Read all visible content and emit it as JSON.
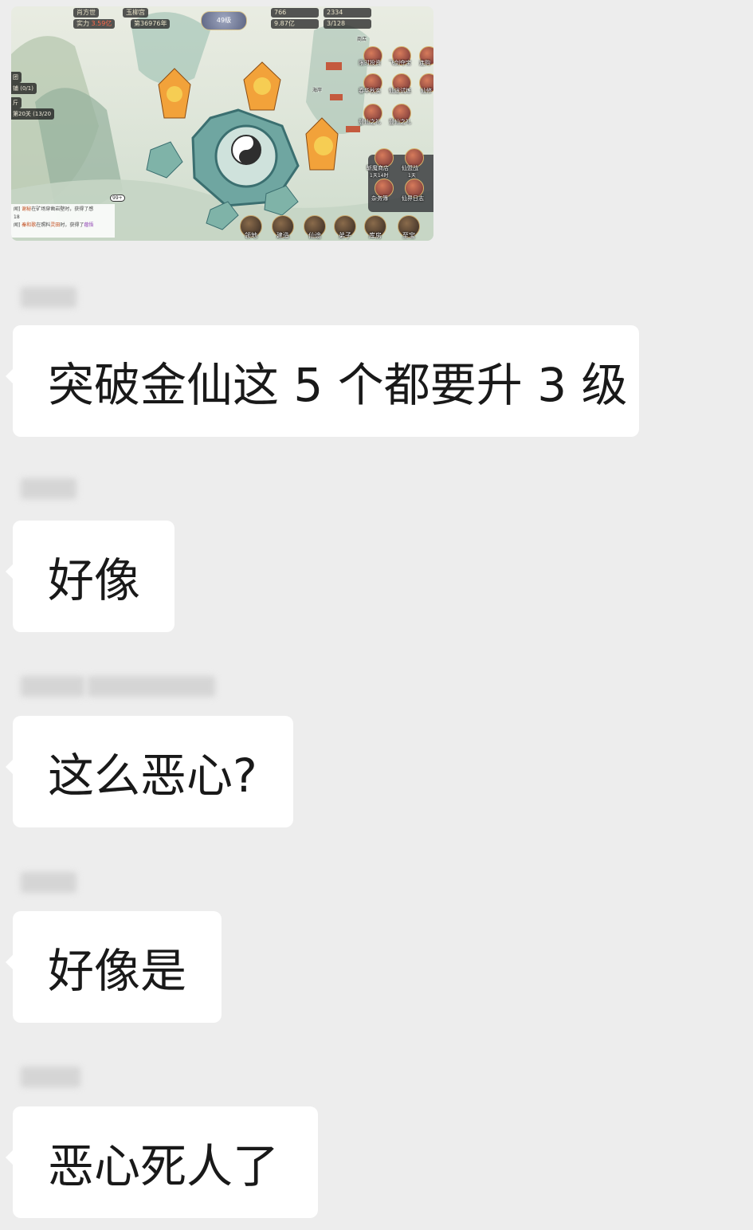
{
  "game_screenshot": {
    "top_bar": {
      "player_name": "肖方世",
      "sect_name": "玉柳宫",
      "power_label": "实力",
      "power_value": "3.59亿",
      "rank_text": "第36976年",
      "level_badge": "49级",
      "res1": "766",
      "res2": "2334",
      "res3": "9.87亿",
      "res4": "3/128"
    },
    "side_tasks": [
      "团",
      "铺 (0/1)",
      "斤",
      "第20关 (13/20"
    ],
    "right_icons": [
      "限时投资",
      "飞剑夺宝",
      "连购",
      "春华秋实",
      "仙途试炼",
      "仙修",
      "登仙之礼",
      "登仙之礼",
      "斩魔商店",
      "仙盟战",
      "杂务簿",
      "仙界日志"
    ],
    "right_icon_subtext": [
      "1天14时",
      "1天"
    ],
    "small_tags": [
      "商店",
      "海岸"
    ],
    "chat_lines": [
      {
        "prefix": "闻]",
        "name": "谢秘",
        "text": "在矿场穿凿岩壁时，获得了感",
        "tail": "18"
      },
      {
        "prefix": "闻]",
        "name": "秦和歌",
        "text": "在照料",
        "item": "灵田",
        "text2": "时，获得了",
        "reward": "蓿悟"
      }
    ],
    "chat_badge": "99+",
    "bottom_buttons": [
      "领地",
      "建造",
      "仙途",
      "弟子",
      "库房",
      "至宝"
    ]
  },
  "messages": [
    {
      "text": "突破金仙这 5 个都要升 3 级"
    },
    {
      "text": "好像"
    },
    {
      "text": "这么恶心?"
    },
    {
      "text": "好像是"
    },
    {
      "text": "恶心死人了"
    }
  ],
  "colors": {
    "background": "#ededed",
    "bubble": "#ffffff",
    "text": "#191919"
  }
}
